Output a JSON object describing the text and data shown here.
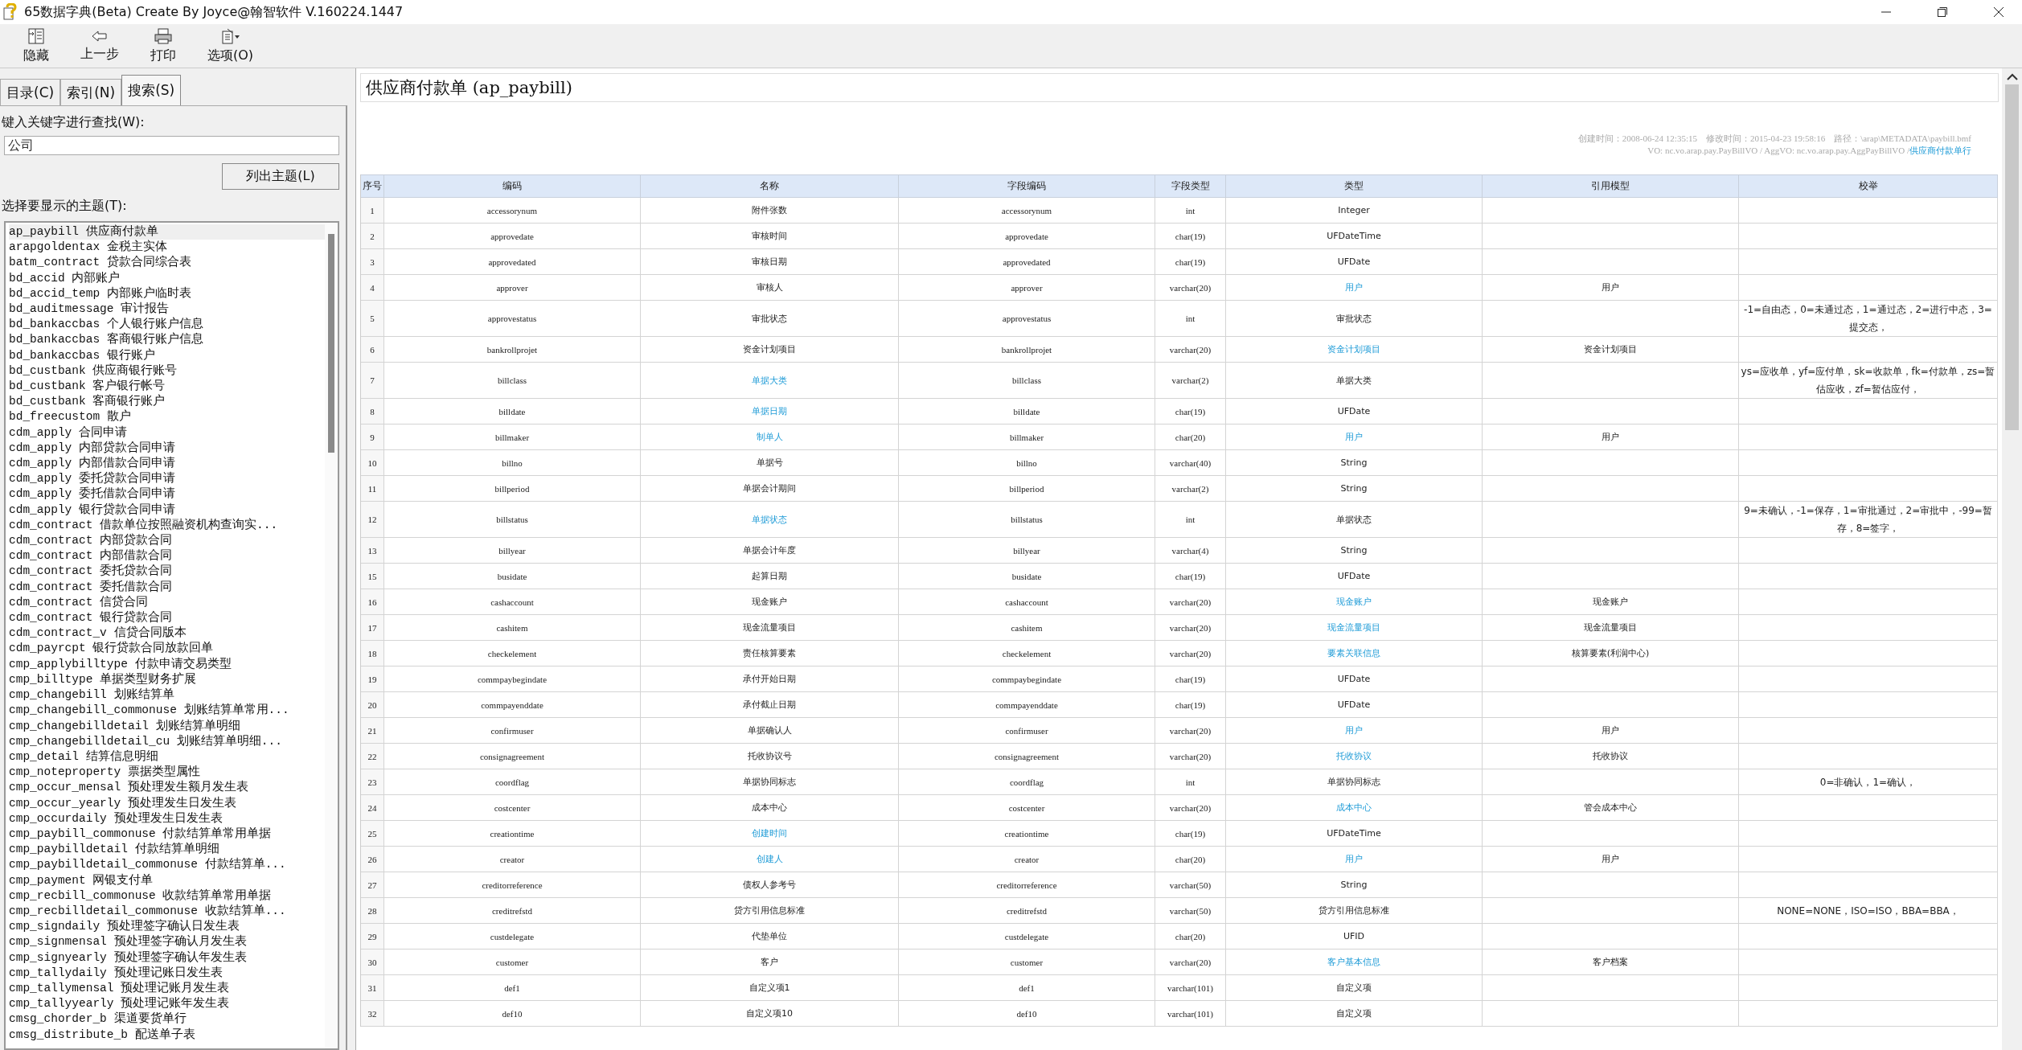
{
  "window": {
    "title": "65数据字典(Beta) Create By Joyce@翰智软件 V.160224.1447"
  },
  "toolbar": [
    {
      "kind": "hide",
      "label": "隐藏"
    },
    {
      "kind": "back",
      "label": "上一步"
    },
    {
      "kind": "print",
      "label": "打印"
    },
    {
      "kind": "options",
      "label": "选项(O)"
    }
  ],
  "tabs": [
    {
      "label": "目录(C)",
      "selected": false
    },
    {
      "label": "索引(N)",
      "selected": false
    },
    {
      "label": "搜索(S)",
      "selected": true
    }
  ],
  "search": {
    "label": "键入关键字进行查找(W):",
    "value": "公司",
    "button": "列出主题(L)",
    "list_label": "选择要显示的主题(T):"
  },
  "topics": [
    {
      "text": "ap_paybill 供应商付款单",
      "selected": true
    },
    {
      "text": "arapgoldentax 金税主实体",
      "selected": false
    },
    {
      "text": "batm_contract 贷款合同综合表",
      "selected": false
    },
    {
      "text": "bd_accid 内部账户",
      "selected": false
    },
    {
      "text": "bd_accid_temp 内部账户临时表",
      "selected": false
    },
    {
      "text": "bd_auditmessage 审计报告",
      "selected": false
    },
    {
      "text": "bd_bankaccbas 个人银行账户信息",
      "selected": false
    },
    {
      "text": "bd_bankaccbas 客商银行账户信息",
      "selected": false
    },
    {
      "text": "bd_bankaccbas 银行账户",
      "selected": false
    },
    {
      "text": "bd_custbank 供应商银行账号",
      "selected": false
    },
    {
      "text": "bd_custbank 客户银行帐号",
      "selected": false
    },
    {
      "text": "bd_custbank 客商银行账户",
      "selected": false
    },
    {
      "text": "bd_freecustom 散户",
      "selected": false
    },
    {
      "text": "cdm_apply 合同申请",
      "selected": false
    },
    {
      "text": "cdm_apply 内部贷款合同申请",
      "selected": false
    },
    {
      "text": "cdm_apply 内部借款合同申请",
      "selected": false
    },
    {
      "text": "cdm_apply 委托贷款合同申请",
      "selected": false
    },
    {
      "text": "cdm_apply 委托借款合同申请",
      "selected": false
    },
    {
      "text": "cdm_apply 银行贷款合同申请",
      "selected": false
    },
    {
      "text": "cdm_contract 借款单位按照融资机构查询实...",
      "selected": false
    },
    {
      "text": "cdm_contract 内部贷款合同",
      "selected": false
    },
    {
      "text": "cdm_contract 内部借款合同",
      "selected": false
    },
    {
      "text": "cdm_contract 委托贷款合同",
      "selected": false
    },
    {
      "text": "cdm_contract 委托借款合同",
      "selected": false
    },
    {
      "text": "cdm_contract 信贷合同",
      "selected": false
    },
    {
      "text": "cdm_contract 银行贷款合同",
      "selected": false
    },
    {
      "text": "cdm_contract_v 信贷合同版本",
      "selected": false
    },
    {
      "text": "cdm_payrcpt 银行贷款合同放款回单",
      "selected": false
    },
    {
      "text": "cmp_applybilltype 付款申请交易类型",
      "selected": false
    },
    {
      "text": "cmp_billtype 单据类型财务扩展",
      "selected": false
    },
    {
      "text": "cmp_changebill 划账结算单",
      "selected": false
    },
    {
      "text": "cmp_changebill_commonuse 划账结算单常用...",
      "selected": false
    },
    {
      "text": "cmp_changebilldetail 划账结算单明细",
      "selected": false
    },
    {
      "text": "cmp_changebilldetail_cu 划账结算单明细...",
      "selected": false
    },
    {
      "text": "cmp_detail 结算信息明细",
      "selected": false
    },
    {
      "text": "cmp_noteproperty 票据类型属性",
      "selected": false
    },
    {
      "text": "cmp_occur_mensal 预处理发生额月发生表",
      "selected": false
    },
    {
      "text": "cmp_occur_yearly 预处理发生日发生表",
      "selected": false
    },
    {
      "text": "cmp_occurdaily 预处理发生日发生表",
      "selected": false
    },
    {
      "text": "cmp_paybill_commonuse 付款结算单常用单据",
      "selected": false
    },
    {
      "text": "cmp_paybilldetail 付款结算单明细",
      "selected": false
    },
    {
      "text": "cmp_paybilldetail_commonuse 付款结算单...",
      "selected": false
    },
    {
      "text": "cmp_payment 网银支付单",
      "selected": false
    },
    {
      "text": "cmp_recbill_commonuse 收款结算单常用单据",
      "selected": false
    },
    {
      "text": "cmp_recbilldetail_commonuse 收款结算单...",
      "selected": false
    },
    {
      "text": "cmp_signdaily 预处理签字确认日发生表",
      "selected": false
    },
    {
      "text": "cmp_signmensal 预处理签字确认月发生表",
      "selected": false
    },
    {
      "text": "cmp_signyearly 预处理签字确认年发生表",
      "selected": false
    },
    {
      "text": "cmp_tallydaily 预处理记账日发生表",
      "selected": false
    },
    {
      "text": "cmp_tallymensal 预处理记账月发生表",
      "selected": false
    },
    {
      "text": "cmp_tallyyearly 预处理记账年发生表",
      "selected": false
    },
    {
      "text": "cmsg_chorder_b 渠道要货单行",
      "selected": false
    },
    {
      "text": "cmsg_distribute_b 配送单子表",
      "selected": false
    }
  ],
  "page": {
    "title": "供应商付款单 (ap_paybill)",
    "meta": "创建时间：2008-06-24 12:35:15　修改时间：2015-04-23 19:58:16　路径：\\arap\\METADATA\\paybill.bmf",
    "classes": "VO: nc.vo.arap.pay.PayBillVO / AggVO: nc.vo.arap.pay.AggPayBillVO / ",
    "link": "供应商付款单行"
  },
  "table": {
    "columns": [
      "序号",
      "编码",
      "名称",
      "字段编码",
      "字段类型",
      "类型",
      "引用模型",
      "校举"
    ],
    "rows": [
      {
        "no": "1",
        "code": "accessorynum",
        "name": "附件张数",
        "name_link": false,
        "field": "accessorynum",
        "field_type": "int",
        "type": "Integer",
        "type_link": false
      },
      {
        "no": "2",
        "code": "approvedate",
        "name": "审核时间",
        "name_link": false,
        "field": "approvedate",
        "field_type": "char(19)",
        "type": "UFDateTime",
        "type_link": false
      },
      {
        "no": "3",
        "code": "approvedated",
        "name": "审核日期",
        "name_link": false,
        "field": "approvedated",
        "field_type": "char(19)",
        "type": "UFDate",
        "type_link": false
      },
      {
        "no": "4",
        "code": "approver",
        "name": "审核人",
        "name_link": false,
        "field": "approver",
        "field_type": "varchar(20)",
        "type": "用户",
        "type_link": true,
        "ref_model": "用户"
      },
      {
        "no": "5",
        "code": "approvestatus",
        "name": "审批状态",
        "name_link": false,
        "field": "approvestatus",
        "field_type": "int",
        "type": "审批状态",
        "type_link": false,
        "enum": "-1=自由态，0=未通过态，1=通过态，2=进行中态，3=提交态，"
      },
      {
        "no": "6",
        "code": "bankrollprojet",
        "name": "资金计划项目",
        "name_link": false,
        "field": "bankrollprojet",
        "field_type": "varchar(20)",
        "type": "资金计划项目",
        "type_link": true,
        "ref_model": "资金计划项目"
      },
      {
        "no": "7",
        "code": "billclass",
        "name": "单据大类",
        "name_link": true,
        "field": "billclass",
        "field_type": "varchar(2)",
        "type": "单据大类",
        "type_link": false,
        "enum": "ys=应收单，yf=应付单，sk=收款单，fk=付款单，zs=暂估应收，zf=暂估应付，"
      },
      {
        "no": "8",
        "code": "billdate",
        "name": "单据日期",
        "name_link": true,
        "field": "billdate",
        "field_type": "char(19)",
        "type": "UFDate",
        "type_link": false
      },
      {
        "no": "9",
        "code": "billmaker",
        "name": "制单人",
        "name_link": true,
        "field": "billmaker",
        "field_type": "char(20)",
        "type": "用户",
        "type_link": true,
        "ref_model": "用户"
      },
      {
        "no": "10",
        "code": "billno",
        "name": "单据号",
        "name_link": false,
        "field": "billno",
        "field_type": "varchar(40)",
        "type": "String",
        "type_link": false
      },
      {
        "no": "11",
        "code": "billperiod",
        "name": "单据会计期间",
        "name_link": false,
        "field": "billperiod",
        "field_type": "varchar(2)",
        "type": "String",
        "type_link": false
      },
      {
        "no": "12",
        "code": "billstatus",
        "name": "单据状态",
        "name_link": true,
        "field": "billstatus",
        "field_type": "int",
        "type": "单据状态",
        "type_link": false,
        "enum": "9=未确认，-1=保存，1=审批通过，2=审批中，-99=暂存，8=签字，"
      },
      {
        "no": "13",
        "code": "billyear",
        "name": "单据会计年度",
        "name_link": false,
        "field": "billyear",
        "field_type": "varchar(4)",
        "type": "String",
        "type_link": false
      },
      {
        "no": "15",
        "code": "busidate",
        "name": "起算日期",
        "name_link": false,
        "field": "busidate",
        "field_type": "char(19)",
        "type": "UFDate",
        "type_link": false
      },
      {
        "no": "16",
        "code": "cashaccount",
        "name": "现金账户",
        "name_link": false,
        "field": "cashaccount",
        "field_type": "varchar(20)",
        "type": "现金账户",
        "type_link": true,
        "ref_model": "现金账户"
      },
      {
        "no": "17",
        "code": "cashitem",
        "name": "现金流量项目",
        "name_link": false,
        "field": "cashitem",
        "field_type": "varchar(20)",
        "type": "现金流量项目",
        "type_link": true,
        "ref_model": "现金流量项目"
      },
      {
        "no": "18",
        "code": "checkelement",
        "name": "责任核算要素",
        "name_link": false,
        "field": "checkelement",
        "field_type": "varchar(20)",
        "type": "要素关联信息",
        "type_link": true,
        "ref_model": "核算要素(利润中心)"
      },
      {
        "no": "19",
        "code": "commpaybegindate",
        "name": "承付开始日期",
        "name_link": false,
        "field": "commpaybegindate",
        "field_type": "char(19)",
        "type": "UFDate",
        "type_link": false
      },
      {
        "no": "20",
        "code": "commpayenddate",
        "name": "承付截止日期",
        "name_link": false,
        "field": "commpayenddate",
        "field_type": "char(19)",
        "type": "UFDate",
        "type_link": false
      },
      {
        "no": "21",
        "code": "confirmuser",
        "name": "单据确认人",
        "name_link": false,
        "field": "confirmuser",
        "field_type": "varchar(20)",
        "type": "用户",
        "type_link": true,
        "ref_model": "用户"
      },
      {
        "no": "22",
        "code": "consignagreement",
        "name": "托收协议号",
        "name_link": false,
        "field": "consignagreement",
        "field_type": "varchar(20)",
        "type": "托收协议",
        "type_link": true,
        "ref_model": "托收协议"
      },
      {
        "no": "23",
        "code": "coordflag",
        "name": "单据协同标志",
        "name_link": false,
        "field": "coordflag",
        "field_type": "int",
        "type": "单据协同标志",
        "type_link": false,
        "enum": "0=非确认，1=确认，"
      },
      {
        "no": "24",
        "code": "costcenter",
        "name": "成本中心",
        "name_link": false,
        "field": "costcenter",
        "field_type": "varchar(20)",
        "type": "成本中心",
        "type_link": true,
        "ref_model": "管会成本中心"
      },
      {
        "no": "25",
        "code": "creationtime",
        "name": "创建时间",
        "name_link": true,
        "field": "creationtime",
        "field_type": "char(19)",
        "type": "UFDateTime",
        "type_link": false
      },
      {
        "no": "26",
        "code": "creator",
        "name": "创建人",
        "name_link": true,
        "field": "creator",
        "field_type": "char(20)",
        "type": "用户",
        "type_link": true,
        "ref_model": "用户"
      },
      {
        "no": "27",
        "code": "creditorreference",
        "name": "债权人参考号",
        "name_link": false,
        "field": "creditorreference",
        "field_type": "varchar(50)",
        "type": "String",
        "type_link": false
      },
      {
        "no": "28",
        "code": "creditrefstd",
        "name": "贷方引用信息标准",
        "name_link": false,
        "field": "creditrefstd",
        "field_type": "varchar(50)",
        "type": "贷方引用信息标准",
        "type_link": false,
        "enum": "NONE=NONE，ISO=ISO，BBA=BBA，"
      },
      {
        "no": "29",
        "code": "custdelegate",
        "name": "代垫单位",
        "name_link": false,
        "field": "custdelegate",
        "field_type": "char(20)",
        "type": "UFID",
        "type_link": false
      },
      {
        "no": "30",
        "code": "customer",
        "name": "客户",
        "name_link": false,
        "field": "customer",
        "field_type": "varchar(20)",
        "type": "客户基本信息",
        "type_link": true,
        "ref_model": "客户档案"
      },
      {
        "no": "31",
        "code": "def1",
        "name": "自定义项1",
        "name_link": false,
        "field": "def1",
        "field_type": "varchar(101)",
        "type": "自定义项",
        "type_link": false
      },
      {
        "no": "32",
        "code": "def10",
        "name": "自定义项10",
        "name_link": false,
        "field": "def10",
        "field_type": "varchar(101)",
        "type": "自定义项",
        "type_link": false
      }
    ]
  }
}
